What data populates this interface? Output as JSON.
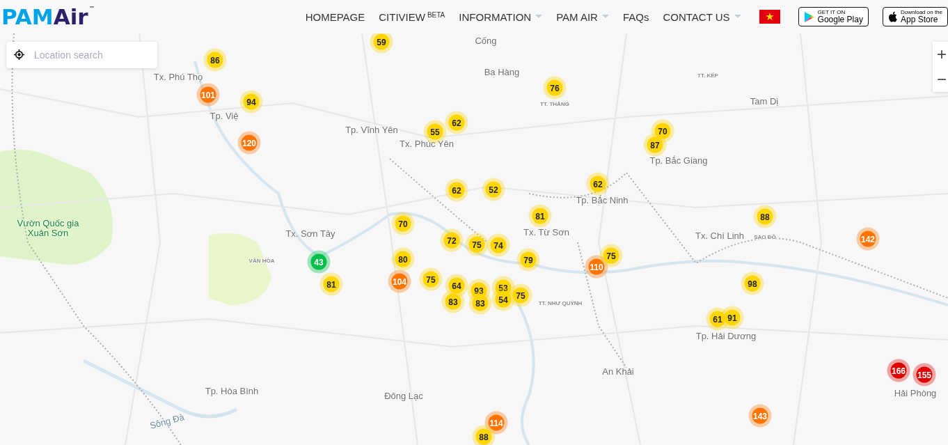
{
  "header": {
    "logo": {
      "primary": "PAM",
      "secondary": "Air",
      "mark": "™"
    },
    "nav": [
      {
        "label": "HOMEPAGE",
        "dropdown": false
      },
      {
        "label": "CITIVIEW",
        "badge": "BETA",
        "dropdown": false
      },
      {
        "label": "INFORMATION",
        "dropdown": true
      },
      {
        "label": "PAM AIR",
        "dropdown": true
      },
      {
        "label": "FAQs",
        "dropdown": false
      },
      {
        "label": "CONTACT US",
        "dropdown": true
      }
    ],
    "stores": [
      {
        "kind": "google",
        "small": "GET IT ON",
        "big": "Google Play"
      },
      {
        "kind": "apple",
        "small": "Download on the",
        "big": "App Store"
      }
    ]
  },
  "search": {
    "placeholder": "Location search"
  },
  "zoom": [
    {
      "label": "+"
    },
    {
      "label": "−"
    }
  ],
  "places": [
    {
      "name": "Cống",
      "kind": "city"
    },
    {
      "name": "Tx. Phú Thọ",
      "kind": "city"
    },
    {
      "name": "Ba Hàng",
      "kind": "city"
    },
    {
      "name": "TT. KÉP",
      "kind": "small"
    },
    {
      "name": "Tp. Việ",
      "kind": "city"
    },
    {
      "name": "TT. THẮNG",
      "kind": "small"
    },
    {
      "name": "Tam Dị",
      "kind": "city"
    },
    {
      "name": "Tp. Vĩnh Yên",
      "kind": "city"
    },
    {
      "name": "Tx. Phúc Yên",
      "kind": "city"
    },
    {
      "name": "Tp. Bắc Giang",
      "kind": "city"
    },
    {
      "name": "Tp. Bắc Ninh",
      "kind": "city"
    },
    {
      "name": "Vườn Quốc gia Xuân Sơn",
      "kind": "park"
    },
    {
      "name": "Tx. Sơn Tây",
      "kind": "city"
    },
    {
      "name": "Tx. Từ Sơn",
      "kind": "city"
    },
    {
      "name": "Tx. Chí Linh",
      "kind": "city"
    },
    {
      "name": "SAO ĐỎ",
      "kind": "small"
    },
    {
      "name": "VÂN HÒA",
      "kind": "small"
    },
    {
      "name": "TT. NHƯ QUỲNH",
      "kind": "small"
    },
    {
      "name": "Tp. Hải Dương",
      "kind": "city"
    },
    {
      "name": "An Khải",
      "kind": "city"
    },
    {
      "name": "Tp. Hòa Bình",
      "kind": "city"
    },
    {
      "name": "Đông Lạc",
      "kind": "city"
    },
    {
      "name": "Hải Phòng",
      "kind": "city"
    },
    {
      "name": "Sông Đà",
      "kind": "river"
    }
  ],
  "stations": [
    {
      "aqi": "59",
      "color": "#ffd600"
    },
    {
      "aqi": "86",
      "color": "#ffd600"
    },
    {
      "aqi": "101",
      "color": "#ff7400"
    },
    {
      "aqi": "94",
      "color": "#ffd600"
    },
    {
      "aqi": "76",
      "color": "#ffd600"
    },
    {
      "aqi": "120",
      "color": "#ff7400"
    },
    {
      "aqi": "55",
      "color": "#ffd600"
    },
    {
      "aqi": "62",
      "color": "#ffd600"
    },
    {
      "aqi": "87",
      "color": "#ffd600"
    },
    {
      "aqi": "70",
      "color": "#ffd600"
    },
    {
      "aqi": "62",
      "color": "#ffd600"
    },
    {
      "aqi": "52",
      "color": "#ffd600"
    },
    {
      "aqi": "62",
      "color": "#ffd600"
    },
    {
      "aqi": "70",
      "color": "#ffd600"
    },
    {
      "aqi": "81",
      "color": "#ffd600"
    },
    {
      "aqi": "88",
      "color": "#ffd600"
    },
    {
      "aqi": "72",
      "color": "#ffd600"
    },
    {
      "aqi": "75",
      "color": "#ffd600"
    },
    {
      "aqi": "74",
      "color": "#ffd600"
    },
    {
      "aqi": "142",
      "color": "#ff7400"
    },
    {
      "aqi": "43",
      "color": "#00c04b"
    },
    {
      "aqi": "80",
      "color": "#ffd600"
    },
    {
      "aqi": "79",
      "color": "#ffd600"
    },
    {
      "aqi": "110",
      "color": "#ff7400"
    },
    {
      "aqi": "75",
      "color": "#ffd600"
    },
    {
      "aqi": "81",
      "color": "#ffd600"
    },
    {
      "aqi": "104",
      "color": "#ff7400"
    },
    {
      "aqi": "75",
      "color": "#ffd600"
    },
    {
      "aqi": "64",
      "color": "#ffd600"
    },
    {
      "aqi": "93",
      "color": "#ffd600"
    },
    {
      "aqi": "53",
      "color": "#ffd600"
    },
    {
      "aqi": "98",
      "color": "#ffd600"
    },
    {
      "aqi": "83",
      "color": "#ffd600"
    },
    {
      "aqi": "83",
      "color": "#ffd600"
    },
    {
      "aqi": "54",
      "color": "#ffd600"
    },
    {
      "aqi": "75",
      "color": "#ffd600"
    },
    {
      "aqi": "61",
      "color": "#ffd600"
    },
    {
      "aqi": "91",
      "color": "#ffd600"
    },
    {
      "aqi": "166",
      "color": "#e00000"
    },
    {
      "aqi": "155",
      "color": "#e00000"
    },
    {
      "aqi": "143",
      "color": "#ff7400"
    },
    {
      "aqi": "114",
      "color": "#ff7400"
    },
    {
      "aqi": "88",
      "color": "#ffd600"
    }
  ]
}
